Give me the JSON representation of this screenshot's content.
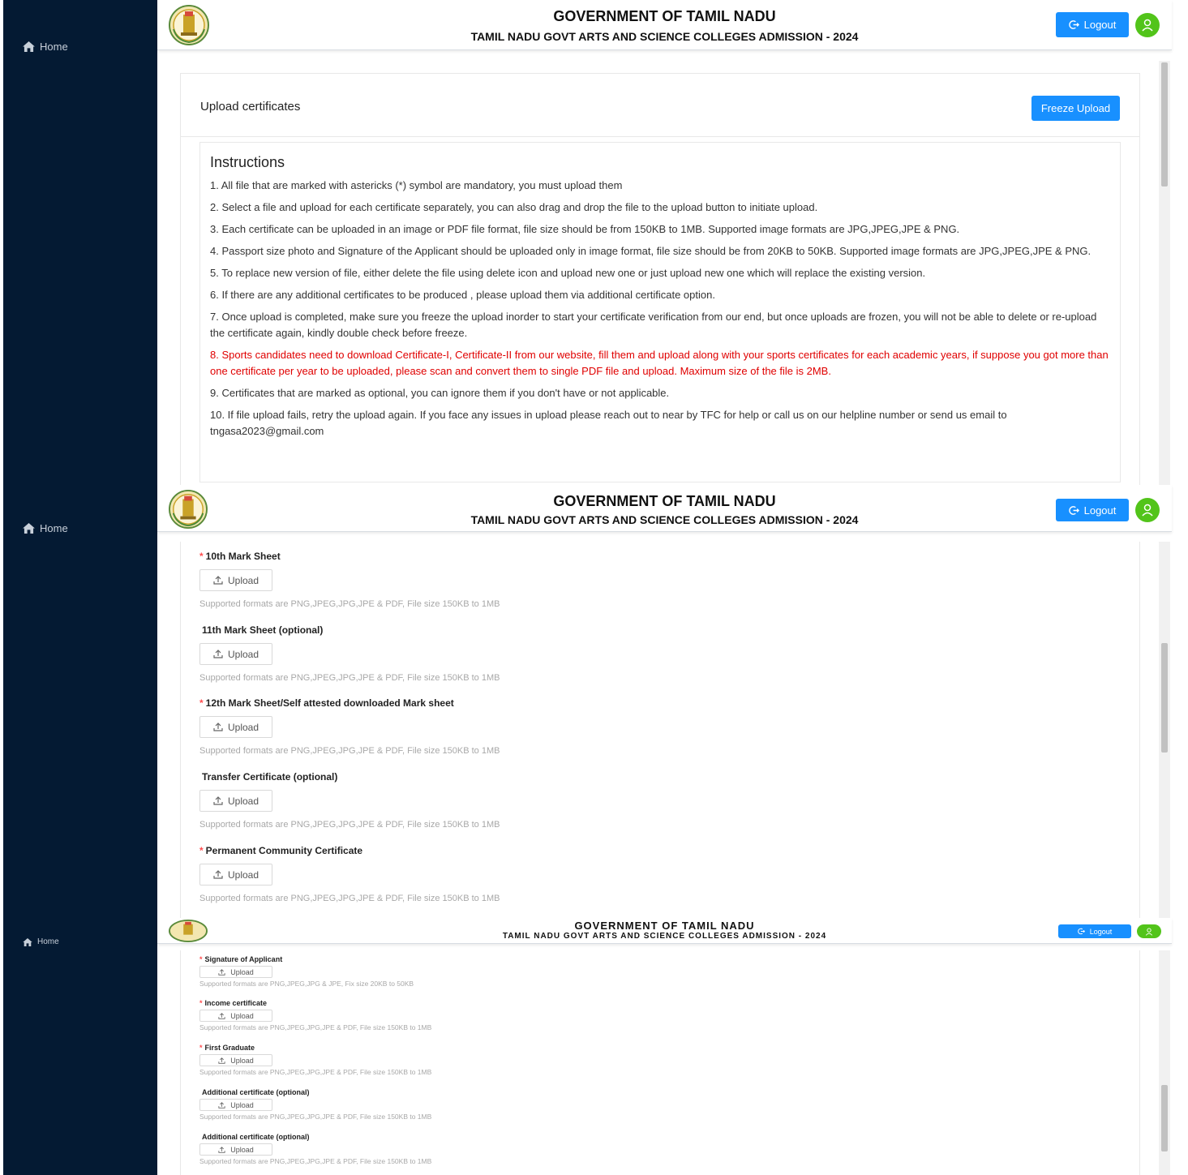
{
  "sidebar": {
    "home_label": "Home"
  },
  "header": {
    "title": "GOVERNMENT OF TAMIL NADU",
    "subtitle": "TAMIL NADU GOVT ARTS AND SCIENCE COLLEGES ADMISSION - 2024",
    "logout_label": "Logout",
    "user_icon": "user-icon",
    "accent_color": "#1890ff",
    "avatar_color": "#52c41a"
  },
  "card": {
    "title": "Upload certificates",
    "freeze_label": "Freeze Upload"
  },
  "instructions": {
    "heading": "Instructions",
    "items": [
      "1. All file that are marked with astericks (*) symbol are mandatory, you must upload them",
      "2. Select a file and upload for each certificate separately, you can also drag and drop the file to the upload button to initiate upload.",
      "3. Each certificate can be uploaded in an image or PDF file format, file size should be from 150KB to 1MB. Supported image formats are JPG,JPEG,JPE & PNG.",
      "4. Passport size photo and Signature of the Applicant should be uploaded only in image format, file size should be from 20KB to 50KB. Supported image formats are JPG,JPEG,JPE & PNG.",
      "5. To replace new version of file, either delete the file using delete icon and upload new one or just upload new one which will replace the existing version.",
      "6. If there are any additional certificates to be produced , please upload them via additional certificate option.",
      "7. Once upload is completed, make sure you freeze the upload inorder to start your certificate verification from our end, but once uploads are frozen, you will not be able to delete or re-upload the certificate again, kindly double check before freeze.",
      "8. Sports candidates need to download Certificate-I, Certificate-II from our website, fill them and upload along with your sports certificates for each academic years, if suppose you got more than one certificate per year to be uploaded, please scan and convert them to single PDF file and upload. Maximum size of the file is 2MB.",
      "9. Certificates that are marked as optional, you can ignore them if you don't have or not applicable.",
      "10. If file upload fails, retry the upload again. If you face any issues in upload please reach out to near by TFC for help or call us on our helpline number or send us email to tngasa2023@gmail.com"
    ],
    "highlight_color": "#e00000"
  },
  "uploads_section2": [
    {
      "label": "10th Mark Sheet",
      "required": "*",
      "button": "Upload",
      "hint": "Supported formats are PNG,JPEG,JPG,JPE & PDF, File size 150KB to 1MB"
    },
    {
      "label": "11th Mark Sheet (optional)",
      "required": "",
      "button": "Upload",
      "hint": "Supported formats are PNG,JPEG,JPG,JPE & PDF, File size 150KB to 1MB"
    },
    {
      "label": "12th Mark Sheet/Self attested downloaded Mark sheet",
      "required": "*",
      "button": "Upload",
      "hint": "Supported formats are PNG,JPEG,JPG,JPE & PDF, File size 150KB to 1MB"
    },
    {
      "label": "Transfer Certificate (optional)",
      "required": "",
      "button": "Upload",
      "hint": "Supported formats are PNG,JPEG,JPG,JPE & PDF, File size 150KB to 1MB"
    },
    {
      "label": "Permanent Community Certificate",
      "required": "*",
      "button": "Upload",
      "hint": "Supported formats are PNG,JPEG,JPG,JPE & PDF, File size 150KB to 1MB"
    }
  ],
  "uploads_section3": [
    {
      "label": "Signature of Applicant",
      "required": "*",
      "button": "Upload",
      "hint": "Supported formats are PNG,JPEG,JPG & JPE, Fix size 20KB to 50KB"
    },
    {
      "label": "Income certificate",
      "required": "*",
      "button": "Upload",
      "hint": "Supported formats are PNG,JPEG,JPG,JPE & PDF, File size 150KB to 1MB"
    },
    {
      "label": "First Graduate",
      "required": "*",
      "button": "Upload",
      "hint": "Supported formats are PNG,JPEG,JPG,JPE & PDF, File size 150KB to 1MB"
    },
    {
      "label": "Additional certificate (optional)",
      "required": "",
      "button": "Upload",
      "hint": "Supported formats are PNG,JPEG,JPG,JPE & PDF, File size 150KB to 1MB"
    },
    {
      "label": "Additional certificate (optional)",
      "required": "",
      "button": "Upload",
      "hint": "Supported formats are PNG,JPEG,JPG,JPE & PDF, File size 150KB to 1MB"
    }
  ]
}
